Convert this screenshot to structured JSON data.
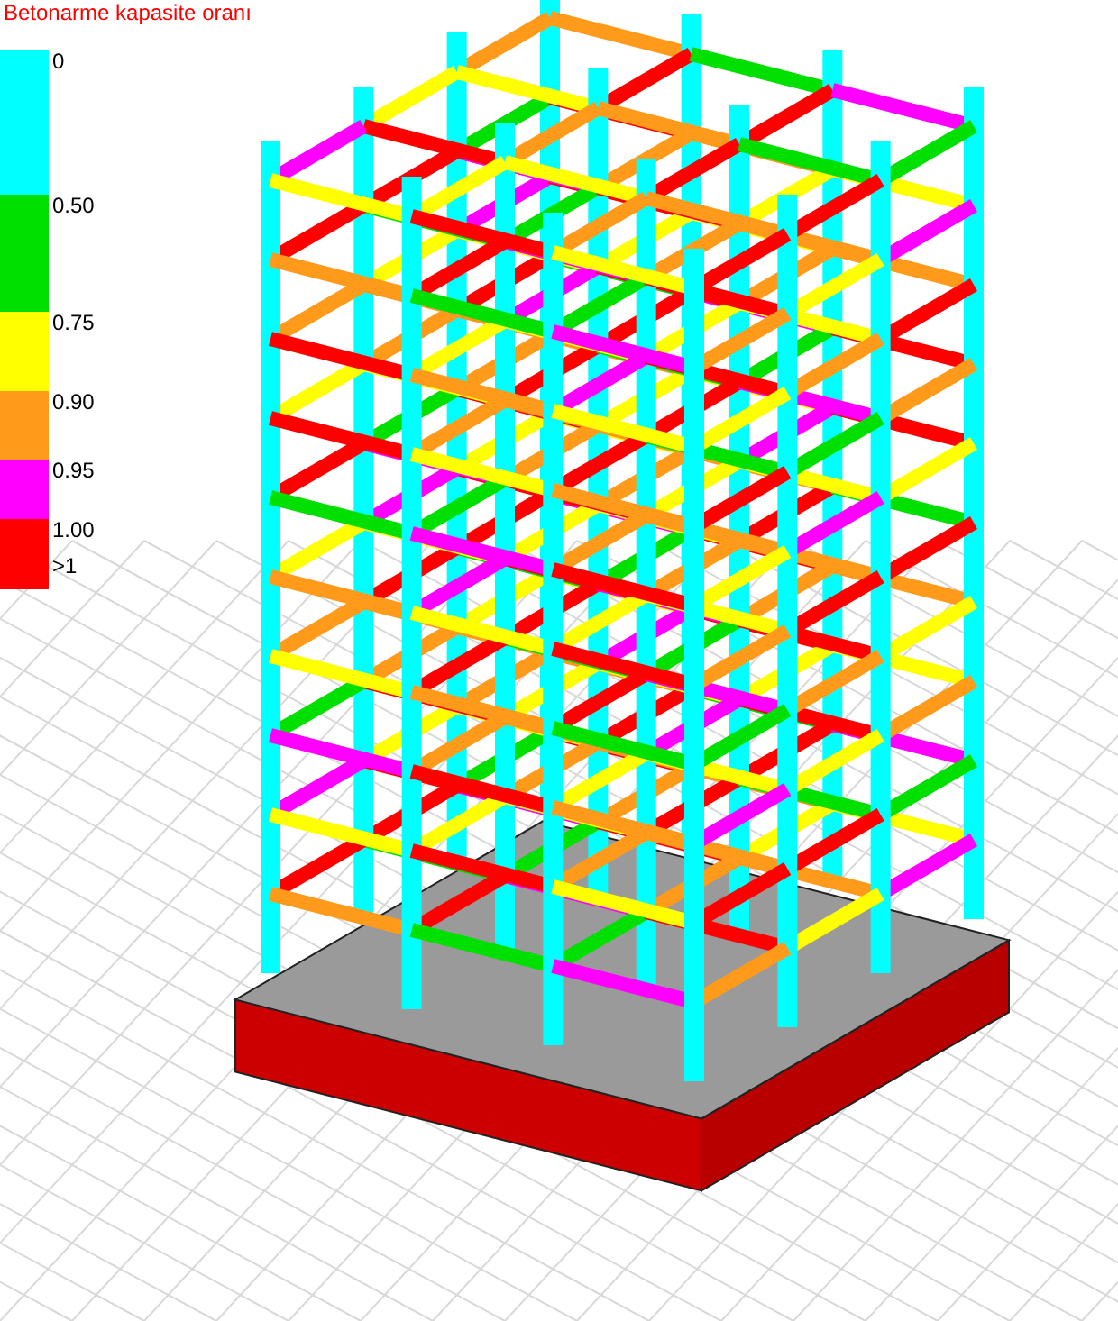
{
  "legend": {
    "title": "Betonarme kapasite oranı",
    "bands": [
      {
        "label": "0",
        "color": "#00ffff"
      },
      {
        "label": "0.50",
        "color": "#00e000"
      },
      {
        "label": "0.75",
        "color": "#ffff00"
      },
      {
        "label": "0.90",
        "color": "#ff9a1a"
      },
      {
        "label": "0.95",
        "color": "#ff00ff"
      },
      {
        "label": "1.00",
        "color": "#ff0000"
      }
    ],
    "end_label": ">1"
  }
}
